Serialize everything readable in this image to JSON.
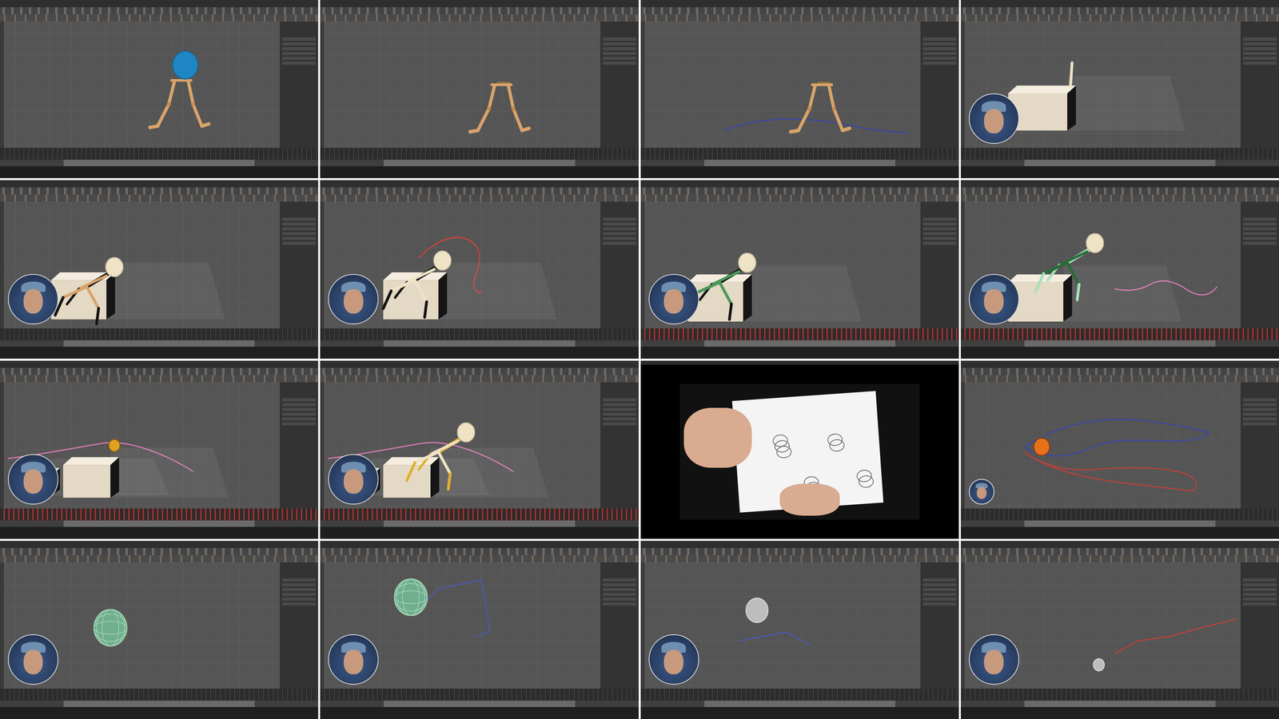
{
  "sheet": {
    "columns": 4,
    "rows": 4
  },
  "tiles": [
    {
      "scene": "walk-ball",
      "webcam": "none",
      "keys": false,
      "trails": []
    },
    {
      "scene": "legs",
      "webcam": "none",
      "keys": false,
      "trails": []
    },
    {
      "scene": "legs-path",
      "webcam": "none",
      "keys": false,
      "trails": [
        "#3b49a8"
      ]
    },
    {
      "scene": "box-top",
      "webcam": "full",
      "keys": false,
      "trails": []
    },
    {
      "scene": "box-climb",
      "webcam": "full",
      "keys": false,
      "trails": []
    },
    {
      "scene": "box-arc",
      "webcam": "full",
      "keys": false,
      "trails": [
        "#e0403a"
      ]
    },
    {
      "scene": "box-lean",
      "webcam": "full",
      "keys": true,
      "trails": []
    },
    {
      "scene": "box-leap",
      "webcam": "full",
      "keys": true,
      "trails": [
        "#e07ab8"
      ]
    },
    {
      "scene": "box-wide-ball",
      "webcam": "full",
      "keys": true,
      "trails": [
        "#e07ab8"
      ]
    },
    {
      "scene": "box-wide-figure",
      "webcam": "full",
      "keys": true,
      "trails": [
        "#e07ab8"
      ]
    },
    {
      "scene": "sketch",
      "webcam": "none",
      "keys": false,
      "trails": []
    },
    {
      "scene": "orb",
      "webcam": "mini",
      "keys": false,
      "trails": [
        "#3b49a8",
        "#c0403a"
      ]
    },
    {
      "scene": "sphere-wire",
      "webcam": "full",
      "keys": false,
      "trails": []
    },
    {
      "scene": "sphere-wire-path",
      "webcam": "full",
      "keys": false,
      "trails": [
        "#4b5bb8"
      ]
    },
    {
      "scene": "sphere-grey",
      "webcam": "full",
      "keys": false,
      "trails": [
        "#4b5bb8"
      ]
    },
    {
      "scene": "sphere-small",
      "webcam": "full",
      "keys": false,
      "trails": [
        "#c0403a"
      ]
    }
  ]
}
